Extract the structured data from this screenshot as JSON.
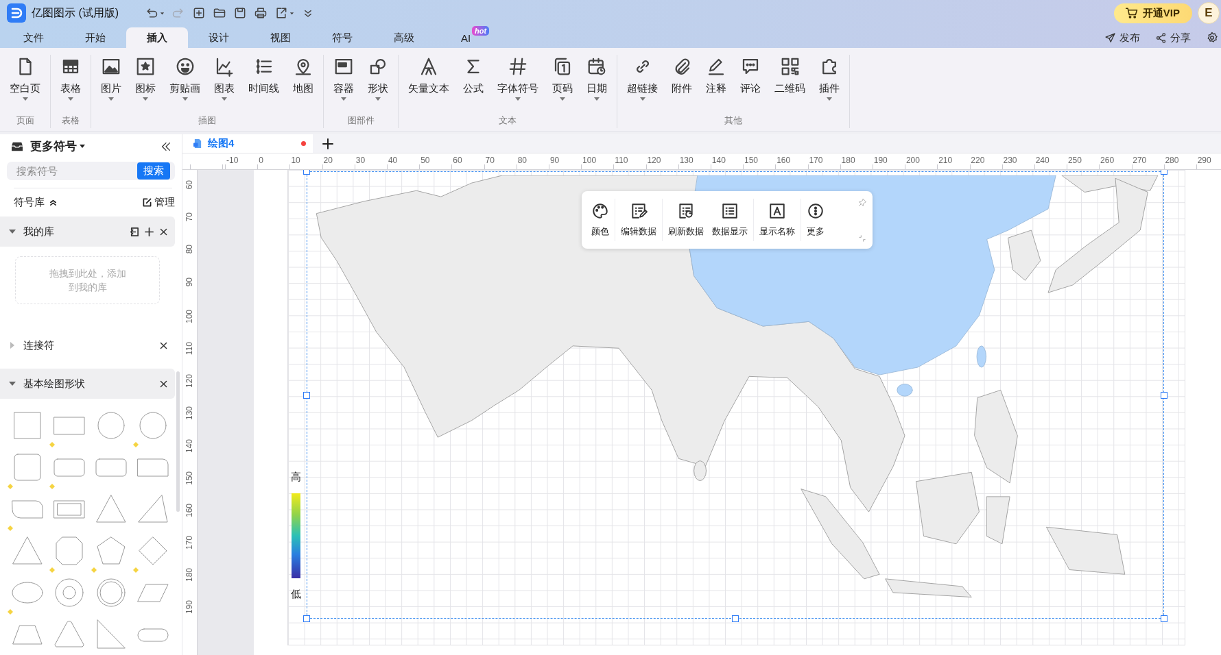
{
  "app": {
    "title": "亿图图示 (试用版)"
  },
  "quick_access": [
    {
      "kind": "undo",
      "disabled": false
    },
    {
      "kind": "redo",
      "disabled": true
    },
    {
      "kind": "new",
      "disabled": false
    },
    {
      "kind": "open",
      "disabled": false
    },
    {
      "kind": "save",
      "disabled": false
    },
    {
      "kind": "print",
      "disabled": false
    },
    {
      "kind": "export",
      "disabled": false
    },
    {
      "kind": "more",
      "disabled": false
    }
  ],
  "menu_tabs": [
    {
      "label": "文件",
      "selected": false
    },
    {
      "label": "开始",
      "selected": false
    },
    {
      "label": "插入",
      "selected": true
    },
    {
      "label": "设计",
      "selected": false
    },
    {
      "label": "视图",
      "selected": false
    },
    {
      "label": "符号",
      "selected": false
    },
    {
      "label": "高级",
      "selected": false
    },
    {
      "label": "AI",
      "selected": false,
      "badge": "hot"
    }
  ],
  "vip_button": "开通VIP",
  "avatar": "E",
  "actions": [
    "发布",
    "分享"
  ],
  "ribbon": [
    {
      "label": "页面",
      "items": [
        {
          "label": "空白页",
          "dropdown": true
        }
      ]
    },
    {
      "label": "表格",
      "items": [
        {
          "label": "表格",
          "dropdown": true
        }
      ]
    },
    {
      "label": "插图",
      "items": [
        {
          "label": "图片",
          "dropdown": true
        },
        {
          "label": "图标",
          "dropdown": true
        },
        {
          "label": "剪贴画",
          "dropdown": true
        },
        {
          "label": "图表",
          "dropdown": true
        },
        {
          "label": "时间线",
          "dropdown": false
        },
        {
          "label": "地图",
          "dropdown": false
        }
      ]
    },
    {
      "label": "图部件",
      "items": [
        {
          "label": "容器",
          "dropdown": true
        },
        {
          "label": "形状",
          "dropdown": true
        }
      ]
    },
    {
      "label": "文本",
      "items": [
        {
          "label": "矢量文本",
          "dropdown": false
        },
        {
          "label": "公式",
          "dropdown": false
        },
        {
          "label": "字体符号",
          "dropdown": true
        },
        {
          "label": "页码",
          "dropdown": true
        },
        {
          "label": "日期",
          "dropdown": true
        }
      ]
    },
    {
      "label": "其他",
      "items": [
        {
          "label": "超链接",
          "dropdown": true
        },
        {
          "label": "附件",
          "dropdown": false
        },
        {
          "label": "注释",
          "dropdown": false
        },
        {
          "label": "评论",
          "dropdown": false
        },
        {
          "label": "二维码",
          "dropdown": false
        },
        {
          "label": "插件",
          "dropdown": true
        }
      ]
    }
  ],
  "document_tab": {
    "label": "绘图4",
    "modified": true
  },
  "sidebar": {
    "title": "更多符号",
    "search": {
      "placeholder": "搜索符号",
      "button": "搜索"
    },
    "library_label": "符号库",
    "manage": "管理",
    "sections": [
      {
        "name": "我的库",
        "expanded": true,
        "drop_hint": "拖拽到此处，添加到我的库"
      },
      {
        "name": "连接符",
        "expanded": false
      },
      {
        "name": "基本绘图形状",
        "expanded": true
      }
    ],
    "shapes": [
      {
        "kind": "square",
        "adjustable": false
      },
      {
        "kind": "rectangle",
        "adjustable": false
      },
      {
        "kind": "circle",
        "adjustable": false
      },
      {
        "kind": "circle",
        "adjustable": false
      },
      {
        "kind": "roundsquare",
        "adjustable": false
      },
      {
        "kind": "roundrect",
        "adjustable": true
      },
      {
        "kind": "roundrect",
        "adjustable": false
      },
      {
        "kind": "cornerrect",
        "adjustable": true
      },
      {
        "kind": "roundcorner",
        "adjustable": true
      },
      {
        "kind": "frame",
        "adjustable": true
      },
      {
        "kind": "triangle",
        "adjustable": false
      },
      {
        "kind": "slanttriangle",
        "adjustable": false
      },
      {
        "kind": "triangle",
        "adjustable": true
      },
      {
        "kind": "octagon",
        "adjustable": false
      },
      {
        "kind": "pentagon",
        "adjustable": false
      },
      {
        "kind": "diamond",
        "adjustable": false
      },
      {
        "kind": "ellipse",
        "adjustable": false
      },
      {
        "kind": "donut",
        "adjustable": true
      },
      {
        "kind": "ring",
        "adjustable": true
      },
      {
        "kind": "parallelogram",
        "adjustable": true
      },
      {
        "kind": "trapezoid",
        "adjustable": true
      },
      {
        "kind": "roundtriangle",
        "adjustable": false
      },
      {
        "kind": "righttriangle",
        "adjustable": false
      },
      {
        "kind": "pill",
        "adjustable": false
      }
    ]
  },
  "ruler": {
    "horizontal": [
      "-10",
      "0",
      "10",
      "20",
      "30",
      "40",
      "50",
      "60",
      "70",
      "80",
      "90",
      "100",
      "110",
      "120",
      "130",
      "140",
      "150",
      "160",
      "170",
      "180",
      "190",
      "200",
      "210",
      "220",
      "230",
      "240",
      "250",
      "260",
      "270",
      "280",
      "290"
    ],
    "vertical": [
      "60",
      "70",
      "80",
      "90",
      "100",
      "110",
      "120",
      "130",
      "140",
      "150",
      "160",
      "170",
      "180",
      "190"
    ]
  },
  "map_toolbar": [
    {
      "label": "颜色",
      "kind": "palette"
    },
    {
      "label": "编辑数据",
      "kind": "edit"
    },
    {
      "label": "刷新数据",
      "kind": "refresh"
    },
    {
      "label": "数据显示",
      "kind": "list"
    },
    {
      "label": "显示名称",
      "kind": "name"
    },
    {
      "label": "更多",
      "kind": "more"
    }
  ],
  "legend": {
    "high": "高",
    "low": "低"
  }
}
